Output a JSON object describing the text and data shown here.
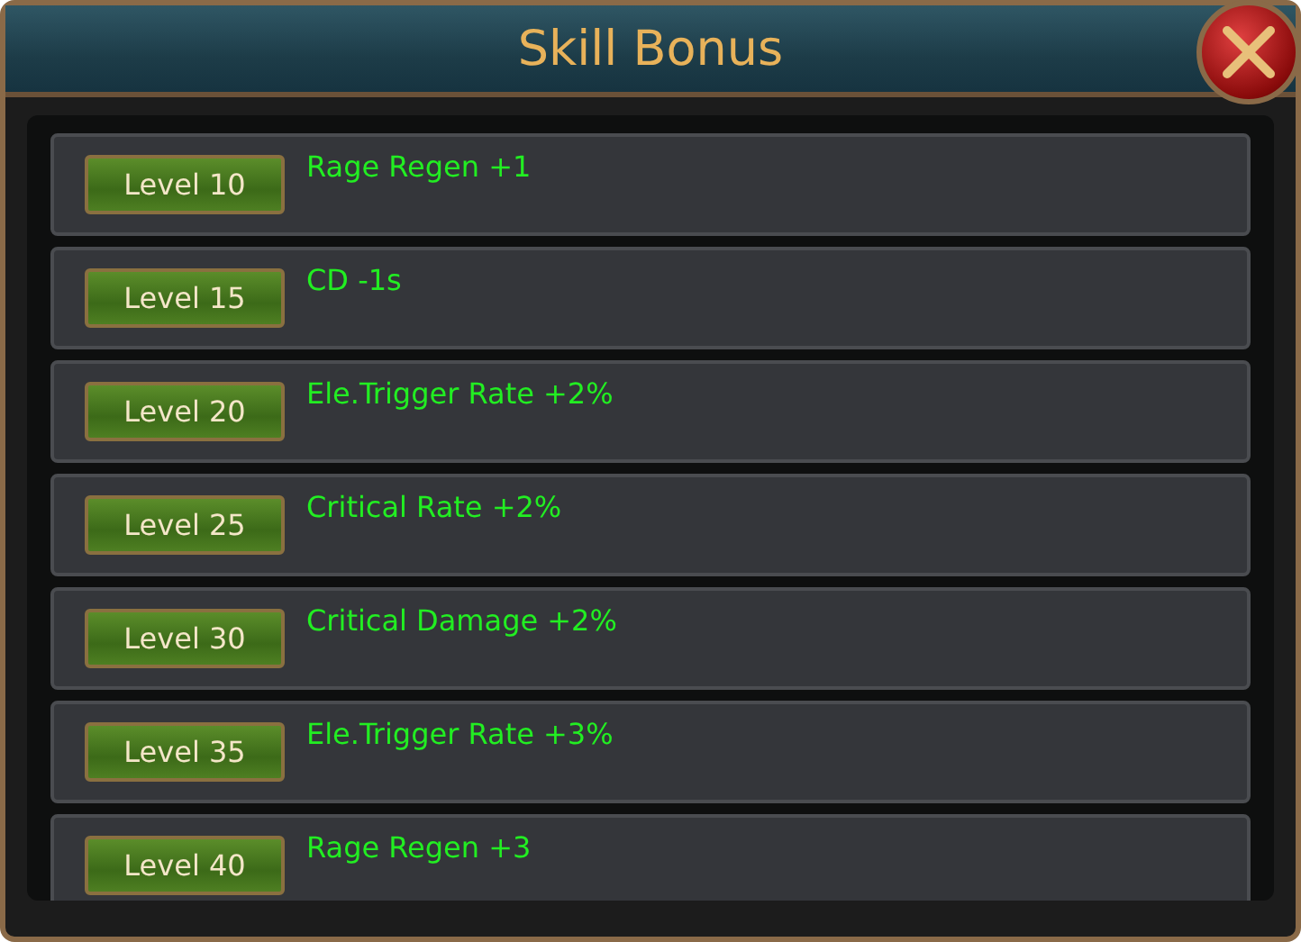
{
  "window": {
    "title": "Skill Bonus"
  },
  "bonuses": [
    {
      "level": "Level 10",
      "effect": "Rage Regen +1"
    },
    {
      "level": "Level 15",
      "effect": "CD -1s"
    },
    {
      "level": "Level 20",
      "effect": "Ele.Trigger Rate +2%"
    },
    {
      "level": "Level 25",
      "effect": "Critical Rate +2%"
    },
    {
      "level": "Level 30",
      "effect": "Critical Damage +2%"
    },
    {
      "level": "Level 35",
      "effect": "Ele.Trigger Rate +3%"
    },
    {
      "level": "Level 40",
      "effect": "Rage Regen +3"
    }
  ]
}
